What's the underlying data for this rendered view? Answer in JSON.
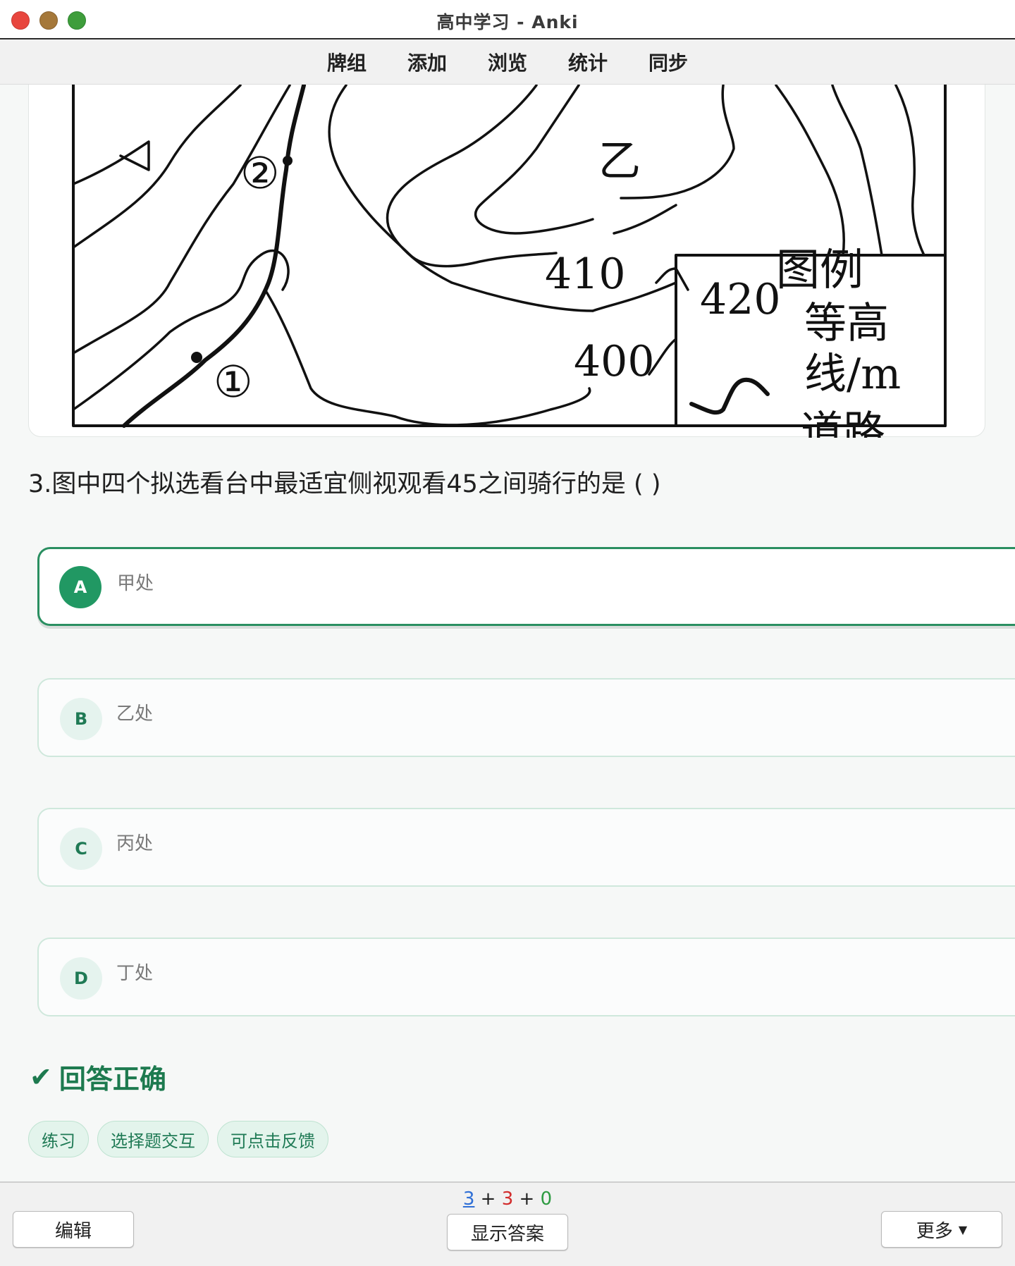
{
  "window": {
    "title": "高中学习 - Anki"
  },
  "toolbar": {
    "items": [
      "牌组",
      "添加",
      "浏览",
      "统计",
      "同步"
    ]
  },
  "map": {
    "labels": {
      "spot_yi": "乙",
      "c410": "410",
      "c420": "420",
      "c400": "400",
      "marker1": "①",
      "marker2": "②"
    },
    "legend": {
      "title": "图例",
      "contour_line1": "等高",
      "contour_line2": "线/m",
      "road": "道路"
    }
  },
  "question": {
    "text": "3.图中四个拟选看台中最适宜侧视观看45之间骑行的是 ( )"
  },
  "options": [
    {
      "letter": "A",
      "text": "甲处",
      "selected": true
    },
    {
      "letter": "B",
      "text": "乙处",
      "selected": false
    },
    {
      "letter": "C",
      "text": "丙处",
      "selected": false
    },
    {
      "letter": "D",
      "text": "丁处",
      "selected": false
    }
  ],
  "result": {
    "icon": "check-icon",
    "text": "回答正确"
  },
  "tags": [
    "练习",
    "选择题交互",
    "可点击反馈"
  ],
  "bottom": {
    "counts": {
      "new": "3",
      "learn": "3",
      "review": "0",
      "sep": "+"
    },
    "edit_label": "编辑",
    "show_answer_label": "显示答案",
    "more_label": "更多"
  },
  "colors": {
    "accent_green": "#219863",
    "new_count": "#2f6fd6",
    "learn_count": "#d22c2c",
    "review_count": "#2e9b42"
  }
}
